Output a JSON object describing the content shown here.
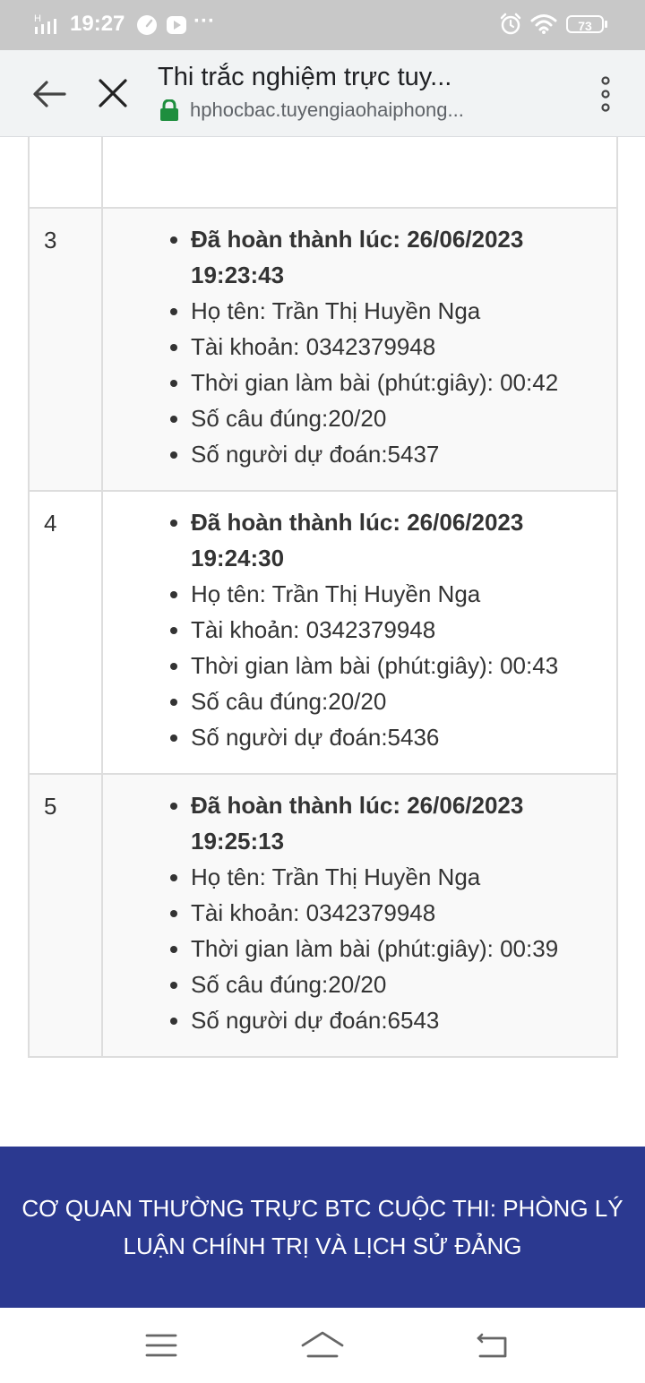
{
  "status_bar": {
    "signal_label": "H",
    "time": "19:27",
    "dots": "···",
    "battery": "73",
    "icons": [
      "signal-icon",
      "speedometer-icon",
      "youtube-icon",
      "alarm-icon",
      "wifi-icon",
      "battery-icon"
    ]
  },
  "browser": {
    "title": "Thi trắc nghiệm trực tuy...",
    "url": "hphocbac.tuyengiaohaiphong...",
    "icons": [
      "back-arrow-icon",
      "close-icon",
      "lock-icon",
      "more-vert-icon"
    ]
  },
  "results": [
    {
      "index": "3",
      "completed": "Đã hoàn thành lúc: 26/06/2023 19:23:43",
      "name": "Họ tên: Trần Thị Huyền Nga",
      "account": "Tài khoản: 0342379948",
      "duration": "Thời gian làm bài (phút:giây): 00:42",
      "correct": "Số câu đúng:20/20",
      "prediction": "Số người dự đoán:5437"
    },
    {
      "index": "4",
      "completed": "Đã hoàn thành lúc: 26/06/2023 19:24:30",
      "name": "Họ tên: Trần Thị Huyền Nga",
      "account": "Tài khoản: 0342379948",
      "duration": "Thời gian làm bài (phút:giây): 00:43",
      "correct": "Số câu đúng:20/20",
      "prediction": "Số người dự đoán:5436"
    },
    {
      "index": "5",
      "completed": "Đã hoàn thành lúc: 26/06/2023 19:25:13",
      "name": "Họ tên: Trần Thị Huyền Nga",
      "account": "Tài khoản: 0342379948",
      "duration": "Thời gian làm bài (phút:giây): 00:39",
      "correct": "Số câu đúng:20/20",
      "prediction": "Số người dự đoán:6543"
    }
  ],
  "footer": {
    "text": "CƠ QUAN THƯỜNG TRỰC BTC CUỘC THI: PHÒNG LÝ LUẬN CHÍNH TRỊ VÀ LỊCH SỬ ĐẢNG"
  },
  "navbar": {
    "icons": [
      "menu-icon",
      "home-icon",
      "back-icon"
    ]
  },
  "colors": {
    "status_bar": "#c8c8c8",
    "browser_bar": "#f1f3f4",
    "footer_bg": "#2b3990",
    "lock": "#1e8e3e",
    "table_border": "#dddddd",
    "row_stripe": "#f9f9f9"
  }
}
